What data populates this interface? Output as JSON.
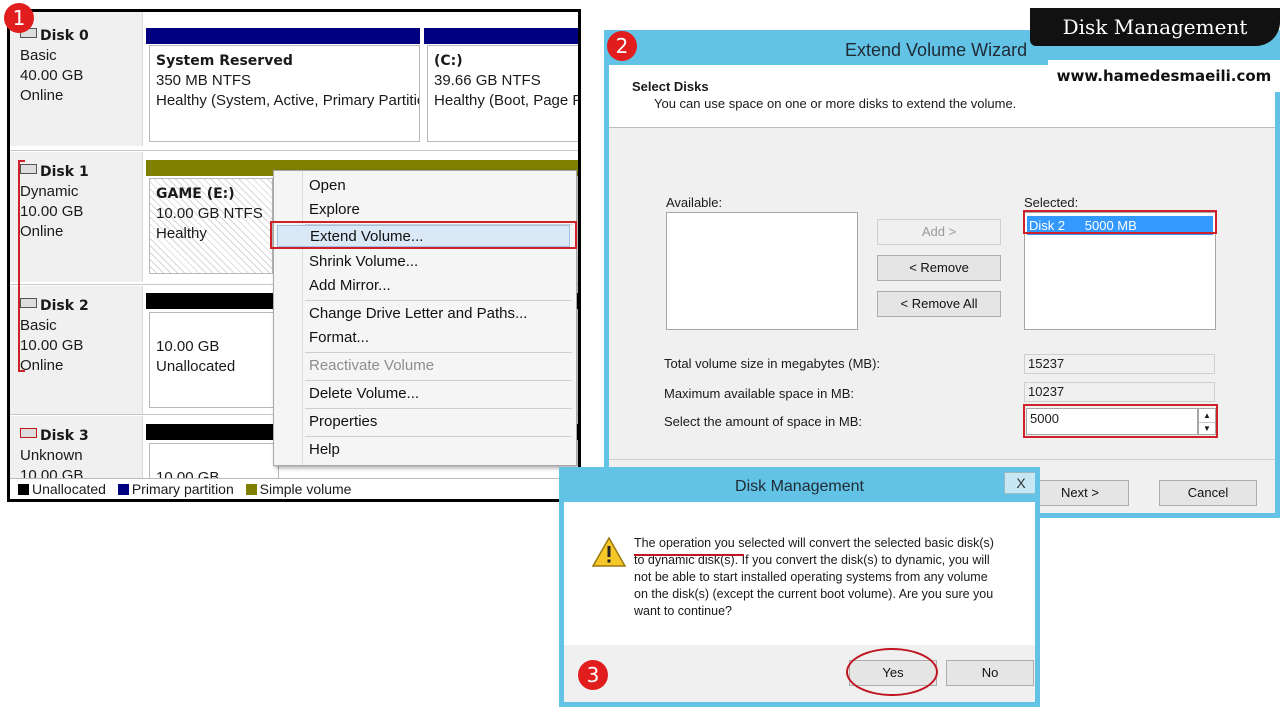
{
  "brand": {
    "title": "Disk Management",
    "url": "www.hamedesmaeili.com"
  },
  "badges": [
    "1",
    "2",
    "3"
  ],
  "disk_management": {
    "disks": [
      {
        "name": "Disk 0",
        "type": "Basic",
        "size": "40.00 GB",
        "status": "Online"
      },
      {
        "name": "Disk 1",
        "type": "Dynamic",
        "size": "10.00 GB",
        "status": "Online"
      },
      {
        "name": "Disk 2",
        "type": "Basic",
        "size": "10.00 GB",
        "status": "Online"
      },
      {
        "name": "Disk 3",
        "type": "Unknown",
        "size": "10.00 GB",
        "status": ""
      }
    ],
    "volumes": {
      "system_reserved": {
        "name": "System Reserved",
        "info": "350 MB NTFS",
        "status": "Healthy (System, Active, Primary Partitic"
      },
      "c": {
        "name": "(C:)",
        "info": "39.66 GB NTFS",
        "status": "Healthy (Boot, Page F"
      },
      "game": {
        "name": "GAME  (E:)",
        "info": "10.00 GB NTFS",
        "status": "Healthy"
      },
      "disk2_unalloc": {
        "size": "10.00 GB",
        "status": "Unallocated"
      },
      "disk3": {
        "size": "10.00 GB"
      }
    },
    "context_menu": {
      "items": [
        "Open",
        "Explore",
        "Extend Volume...",
        "Shrink Volume...",
        "Add Mirror...",
        "Change Drive Letter and Paths...",
        "Format...",
        "Reactivate Volume",
        "Delete Volume...",
        "Properties",
        "Help"
      ]
    },
    "legend": [
      "Unallocated",
      "Primary partition",
      "Simple volume"
    ],
    "colors": {
      "unallocated": "#000000",
      "primary": "#000080",
      "simple": "#808000"
    }
  },
  "wizard": {
    "title": "Extend Volume Wizard",
    "header_title": "Select Disks",
    "header_subtitle": "You can use space on one or more disks to extend the volume.",
    "available_label": "Available:",
    "selected_label": "Selected:",
    "selected_item": {
      "disk": "Disk 2",
      "size": "5000 MB"
    },
    "buttons": {
      "add": "Add >",
      "remove": "< Remove",
      "remove_all": "< Remove All",
      "next": "Next >",
      "cancel": "Cancel"
    },
    "fields": {
      "total_label": "Total volume size in megabytes (MB):",
      "total_value": "15237",
      "max_label": "Maximum available space in MB:",
      "max_value": "10237",
      "amount_label": "Select the amount of space in MB:",
      "amount_value": "5000"
    }
  },
  "confirm_dialog": {
    "title": "Disk Management",
    "close": "X",
    "message_pre": "The operation you selected will convert the selected basic disk(s) ",
    "message_emph": "to dynamic disk(s)",
    "message_post": ". If you convert the disk(s) to dynamic, you will not be able to start installed operating systems from any volume on the disk(s) (except the current boot volume). Are you sure you want to continue?",
    "yes": "Yes",
    "no": "No"
  }
}
